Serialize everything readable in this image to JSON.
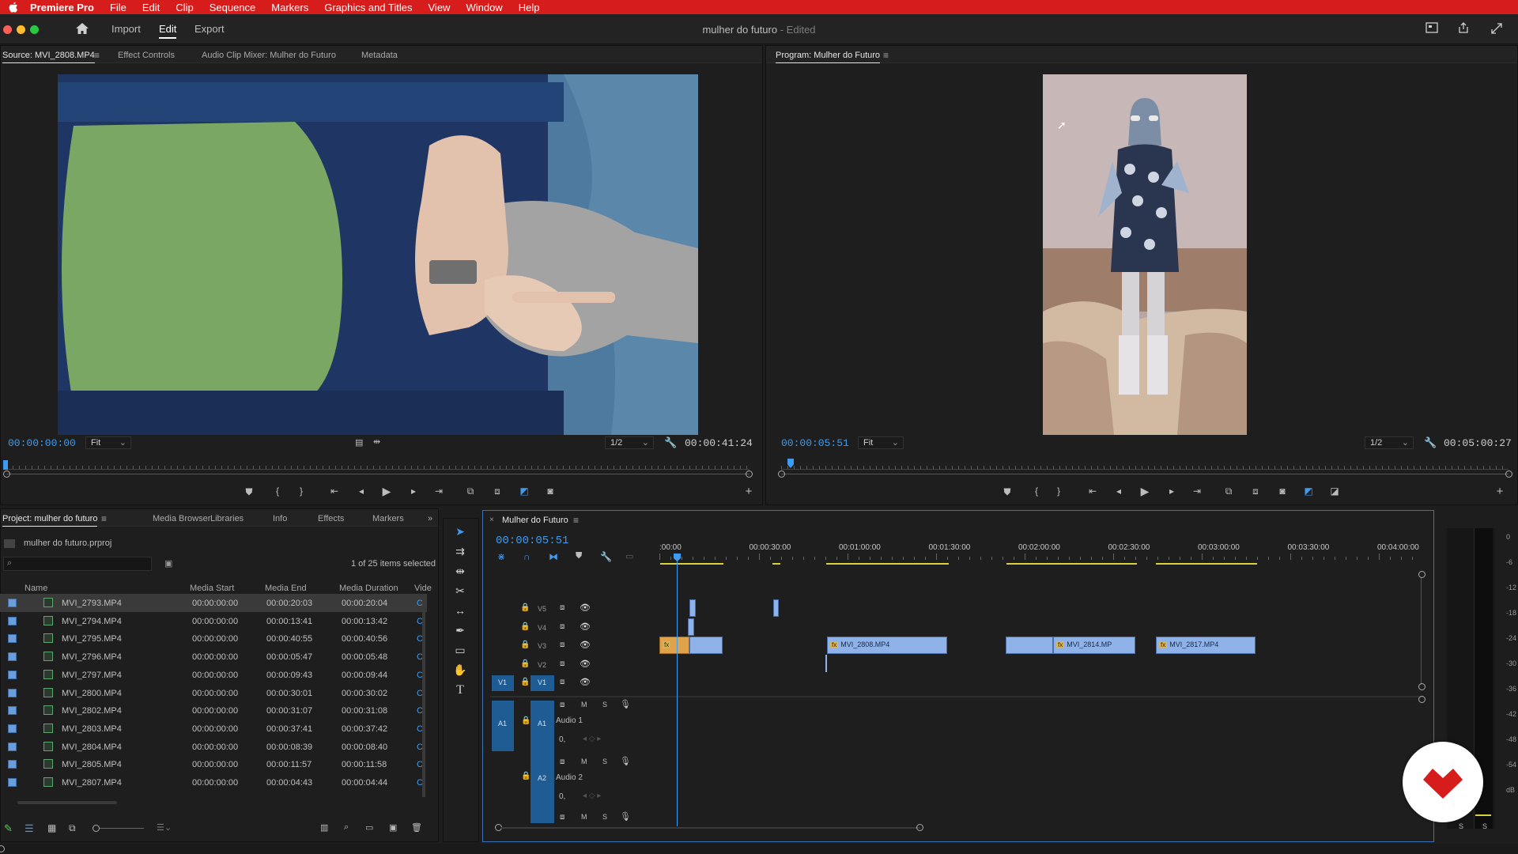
{
  "menubar": {
    "app": "Premiere Pro",
    "items": [
      "File",
      "Edit",
      "Clip",
      "Sequence",
      "Markers",
      "Graphics and Titles",
      "View",
      "Window",
      "Help"
    ]
  },
  "header": {
    "workspaces": [
      "Import",
      "Edit",
      "Export"
    ],
    "active_workspace": "Edit",
    "title": "mulher do futuro",
    "title_suffix": "- Edited"
  },
  "source_panel": {
    "tabs": [
      "Source: MVI_2808.MP4",
      "Effect Controls",
      "Audio Clip Mixer: Mulher do Futuro",
      "Metadata"
    ],
    "timecode": "00:00:00:00",
    "fit": "Fit",
    "resolution": "1/2",
    "duration": "00:00:41:24"
  },
  "program_panel": {
    "tab": "Program: Mulher do Futuro",
    "timecode": "00:00:05:51",
    "fit": "Fit",
    "resolution": "1/2",
    "duration": "00:05:00:27"
  },
  "project_panel": {
    "tabs": [
      "Project: mulher do futuro",
      "Media Browser",
      "Libraries",
      "Info",
      "Effects",
      "Markers"
    ],
    "project_file": "mulher do futuro.prproj",
    "selection_info": "1 of 25 items selected",
    "columns": [
      "Name",
      "Media Start",
      "Media End",
      "Media Duration",
      "Vide"
    ],
    "rows": [
      {
        "name": "MVI_2793.MP4",
        "start": "00:00:00:00",
        "end": "00:00:20:03",
        "duration": "00:00:20:04"
      },
      {
        "name": "MVI_2794.MP4",
        "start": "00:00:00:00",
        "end": "00:00:13:41",
        "duration": "00:00:13:42"
      },
      {
        "name": "MVI_2795.MP4",
        "start": "00:00:00:00",
        "end": "00:00:40:55",
        "duration": "00:00:40:56"
      },
      {
        "name": "MVI_2796.MP4",
        "start": "00:00:00:00",
        "end": "00:00:05:47",
        "duration": "00:00:05:48"
      },
      {
        "name": "MVI_2797.MP4",
        "start": "00:00:00:00",
        "end": "00:00:09:43",
        "duration": "00:00:09:44"
      },
      {
        "name": "MVI_2800.MP4",
        "start": "00:00:00:00",
        "end": "00:00:30:01",
        "duration": "00:00:30:02"
      },
      {
        "name": "MVI_2802.MP4",
        "start": "00:00:00:00",
        "end": "00:00:31:07",
        "duration": "00:00:31:08"
      },
      {
        "name": "MVI_2803.MP4",
        "start": "00:00:00:00",
        "end": "00:00:37:41",
        "duration": "00:00:37:42"
      },
      {
        "name": "MVI_2804.MP4",
        "start": "00:00:00:00",
        "end": "00:00:08:39",
        "duration": "00:00:08:40"
      },
      {
        "name": "MVI_2805.MP4",
        "start": "00:00:00:00",
        "end": "00:00:11:57",
        "duration": "00:00:11:58"
      },
      {
        "name": "MVI_2807.MP4",
        "start": "00:00:00:00",
        "end": "00:00:04:43",
        "duration": "00:00:04:44"
      }
    ]
  },
  "timeline": {
    "sequence": "Mulher do Futuro",
    "timecode": "00:00:05:51",
    "ruler_labels": [
      ":00:00",
      "00:00:30:00",
      "00:01:00:00",
      "00:01:30:00",
      "00:02:00:00",
      "00:02:30:00",
      "00:03:00:00",
      "00:03:30:00",
      "00:04:00:00"
    ],
    "video_tracks": [
      "V5",
      "V4",
      "V3",
      "V2",
      "V1"
    ],
    "audio_tracks": [
      {
        "id": "A1",
        "name": "Audio 1"
      },
      {
        "id": "A2",
        "name": "Audio 2"
      }
    ],
    "track_buttons": {
      "mute": "M",
      "solo": "S",
      "volume": "0,"
    },
    "clips": [
      {
        "label": "MVI_2808.MP4",
        "track": "V3"
      },
      {
        "label": "MVI_2814.MP",
        "track": "V3"
      },
      {
        "label": "MVI_2817.MP4",
        "track": "V3"
      }
    ]
  },
  "audio_meter": {
    "labels": [
      "0",
      "-6",
      "-12",
      "-18",
      "-24",
      "-30",
      "-36",
      "-42",
      "-48",
      "-54",
      "dB"
    ],
    "solo_labels": [
      "S",
      "S"
    ]
  },
  "colors": {
    "menubar": "#d71c1c",
    "accent_blue": "#3d9bf0",
    "clip_blue": "#8fb3e8",
    "work_area": "#d8d23a",
    "logo": "#d71c1c"
  }
}
